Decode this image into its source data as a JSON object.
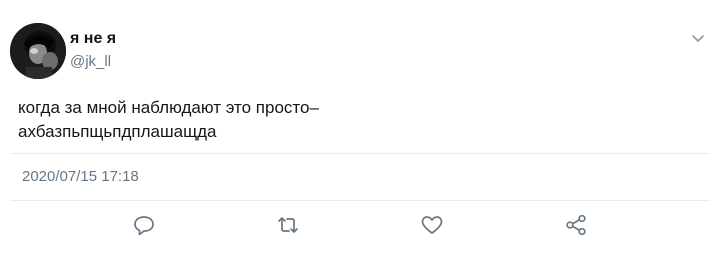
{
  "tweet": {
    "display_name": "я не я",
    "handle": "@jk_ll",
    "text_lines": [
      "когда за мной наблюдают это просто–",
      "ахбазпьпщьпдплашащда"
    ],
    "timestamp": "2020/07/15 17:18"
  },
  "icons": {
    "menu": "chevron-down-icon",
    "reply": "reply-icon",
    "retweet": "retweet-icon",
    "like": "heart-icon",
    "share": "share-icon"
  },
  "colors": {
    "text": "#14171a",
    "secondary": "#657786",
    "divider": "#e6ecf0",
    "action_icon": "#657786"
  }
}
